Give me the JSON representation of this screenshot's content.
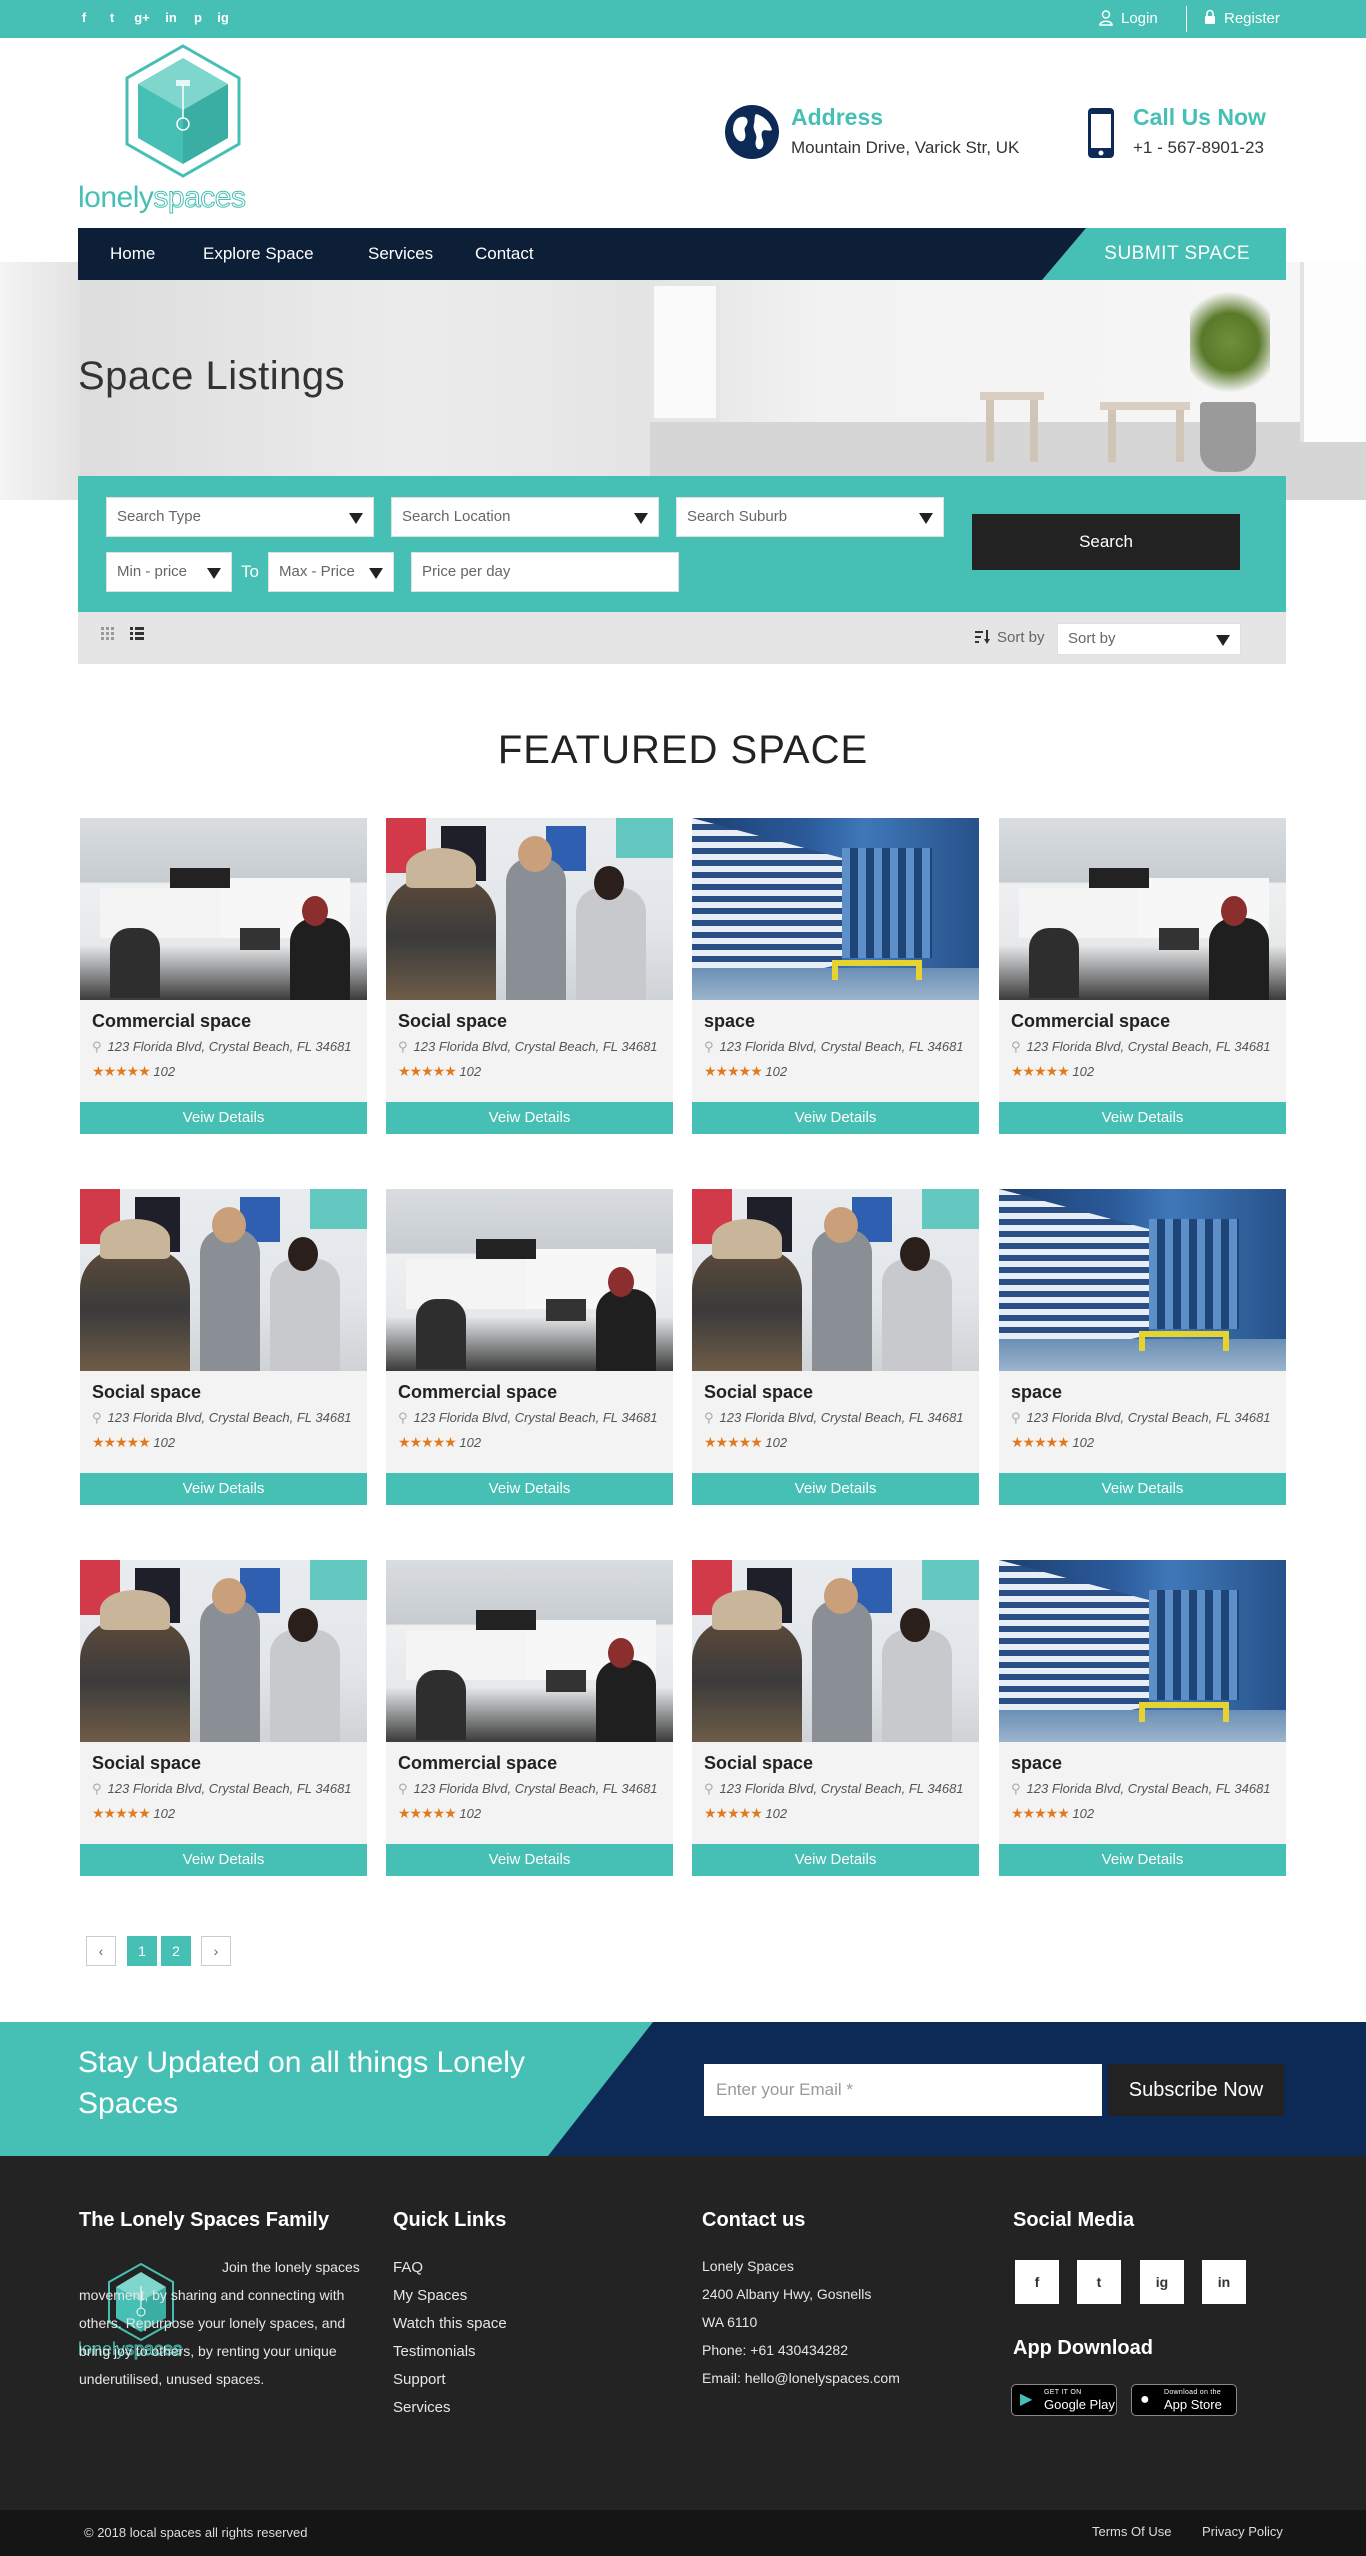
{
  "topbar": {
    "social": [
      "f",
      "t",
      "g+",
      "in",
      "p",
      "ig"
    ],
    "login": "Login",
    "register": "Register"
  },
  "logo": {
    "part1": "lonely",
    "part2": "spaces"
  },
  "header": {
    "address_title": "Address",
    "address_value": "Mountain Drive, Varick Str, UK",
    "call_title": "Call Us Now",
    "call_value": "+1 - 567-8901-23"
  },
  "nav": {
    "items": [
      "Home",
      "Explore Space",
      "Services",
      "Contact"
    ],
    "submit": "SUBMIT SPACE"
  },
  "hero": {
    "title": "Space Listings"
  },
  "search": {
    "type": "Search Type",
    "location": "Search Location",
    "suburb": "Search Suburb",
    "min_price": "Min - price",
    "to": "To",
    "max_price": "Max - Price",
    "price_per_day": "Price per day",
    "button": "Search",
    "sort_label": "Sort by",
    "sort_value": "Sort by"
  },
  "featured": {
    "title": "FEATURED SPACE",
    "cards": [
      {
        "name": "Commercial space",
        "address": "123 Florida Blvd, Crystal Beach, FL 34681",
        "stars": "★★★★★",
        "reviews": "102",
        "button": "Veiw Details",
        "image": "office"
      },
      {
        "name": "Social space",
        "address": "123 Florida Blvd, Crystal Beach, FL 34681",
        "stars": "★★★★★",
        "reviews": "102",
        "button": "Veiw Details",
        "image": "meeting"
      },
      {
        "name": "space",
        "address": "123 Florida Blvd, Crystal Beach, FL 34681",
        "stars": "★★★★★",
        "reviews": "102",
        "button": "Veiw Details",
        "image": "warehouse"
      },
      {
        "name": "Commercial space",
        "address": "123 Florida Blvd, Crystal Beach, FL 34681",
        "stars": "★★★★★",
        "reviews": "102",
        "button": "Veiw Details",
        "image": "office"
      },
      {
        "name": "Social space",
        "address": "123 Florida Blvd, Crystal Beach, FL 34681",
        "stars": "★★★★★",
        "reviews": "102",
        "button": "Veiw Details",
        "image": "meeting"
      },
      {
        "name": "Commercial space",
        "address": "123 Florida Blvd, Crystal Beach, FL 34681",
        "stars": "★★★★★",
        "reviews": "102",
        "button": "Veiw Details",
        "image": "office"
      },
      {
        "name": "Social space",
        "address": "123 Florida Blvd, Crystal Beach, FL 34681",
        "stars": "★★★★★",
        "reviews": "102",
        "button": "Veiw Details",
        "image": "meeting"
      },
      {
        "name": "space",
        "address": "123 Florida Blvd, Crystal Beach, FL 34681",
        "stars": "★★★★★",
        "reviews": "102",
        "button": "Veiw Details",
        "image": "warehouse"
      },
      {
        "name": "Social space",
        "address": "123 Florida Blvd, Crystal Beach, FL 34681",
        "stars": "★★★★★",
        "reviews": "102",
        "button": "Veiw Details",
        "image": "meeting"
      },
      {
        "name": "Commercial space",
        "address": "123 Florida Blvd, Crystal Beach, FL 34681",
        "stars": "★★★★★",
        "reviews": "102",
        "button": "Veiw Details",
        "image": "office"
      },
      {
        "name": "Social space",
        "address": "123 Florida Blvd, Crystal Beach, FL 34681",
        "stars": "★★★★★",
        "reviews": "102",
        "button": "Veiw Details",
        "image": "meeting"
      },
      {
        "name": "space",
        "address": "123 Florida Blvd, Crystal Beach, FL 34681",
        "stars": "★★★★★",
        "reviews": "102",
        "button": "Veiw Details",
        "image": "warehouse"
      }
    ]
  },
  "pagination": {
    "prev": "‹",
    "pages": [
      "1",
      "2"
    ],
    "next": "›"
  },
  "newsletter": {
    "title": "Stay Updated on all things Lonely Spaces",
    "placeholder": "Enter your Email *",
    "button": "Subscribe Now"
  },
  "footer": {
    "family_title": "The Lonely Spaces Family",
    "family_text": "Join the lonely spaces movement, by sharing and connecting with others. Repurpose your lonely spaces, and bring joy to others, by renting your unique underutilised, unused spaces.",
    "quick_title": "Quick Links",
    "quick_links": [
      "FAQ",
      "My Spaces",
      "Watch this space",
      "Testimonials",
      "Support",
      "Services"
    ],
    "contact_title": "Contact us",
    "contact_lines": [
      "Lonely Spaces",
      "2400 Albany Hwy, Gosnells",
      "WA 6110",
      "Phone: +61 430434282",
      "Email: hello@lonelyspaces.com"
    ],
    "social_title": "Social Media",
    "social": [
      "f",
      "t",
      "ig",
      "in"
    ],
    "app_title": "App Download",
    "google_small": "GET IT ON",
    "google_big": "Google Play",
    "apple_small": "Download on the",
    "apple_big": "App Store"
  },
  "bottom": {
    "copyright": "© 2018 local spaces all rights reserved",
    "terms": "Terms Of Use",
    "privacy": "Privacy Policy"
  },
  "colors": {
    "accent": "#46bfb4",
    "navy": "#0d1e37",
    "dark": "#232323",
    "star": "#e07a1e"
  }
}
